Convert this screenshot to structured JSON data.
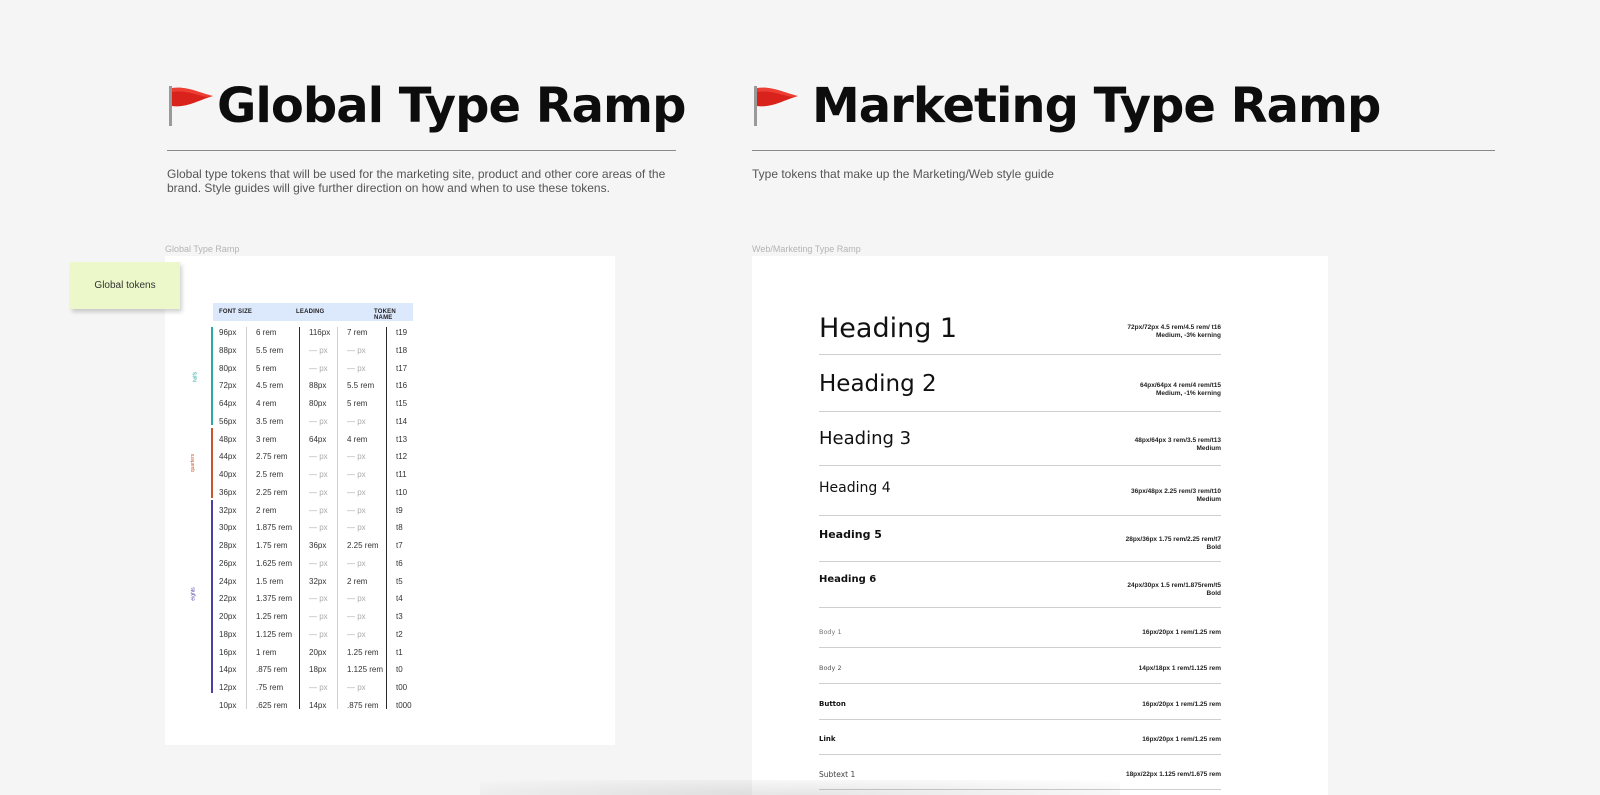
{
  "left": {
    "title": "Global Type Ramp",
    "description": "Global type tokens that will be used for the marketing site, product and other core areas of the brand. Style guides will give further direction on how and when to use these tokens.",
    "frame_label": "Global Type Ramp",
    "sticky_note": "Global tokens",
    "table": {
      "headers": {
        "font_size": "FONT SIZE",
        "leading": "LEADING",
        "token_name": "TOKEN NAME"
      },
      "groups": [
        {
          "label": "halfs",
          "color": "#2aa9a0"
        },
        {
          "label": "quarters",
          "color": "#c8562c"
        },
        {
          "label": "eights",
          "color": "#4a3fa3"
        }
      ],
      "rows": [
        [
          "96px",
          "6 rem",
          "116px",
          "7 rem",
          "t19"
        ],
        [
          "88px",
          "5.5 rem",
          "— px",
          "— px",
          "t18"
        ],
        [
          "80px",
          "5 rem",
          "— px",
          "— px",
          "t17"
        ],
        [
          "72px",
          "4.5 rem",
          "88px",
          "5.5 rem",
          "t16"
        ],
        [
          "64px",
          "4 rem",
          "80px",
          "5 rem",
          "t15"
        ],
        [
          "56px",
          "3.5 rem",
          "— px",
          "— px",
          "t14"
        ],
        [
          "48px",
          "3 rem",
          "64px",
          "4 rem",
          "t13"
        ],
        [
          "44px",
          "2.75 rem",
          "— px",
          "— px",
          "t12"
        ],
        [
          "40px",
          "2.5 rem",
          "— px",
          "— px",
          "t11"
        ],
        [
          "36px",
          "2.25 rem",
          "— px",
          "— px",
          "t10"
        ],
        [
          "32px",
          "2 rem",
          "— px",
          "— px",
          "t9"
        ],
        [
          "30px",
          "1.875 rem",
          "— px",
          "— px",
          "t8"
        ],
        [
          "28px",
          "1.75 rem",
          "36px",
          "2.25 rem",
          "t7"
        ],
        [
          "26px",
          "1.625 rem",
          "— px",
          "— px",
          "t6"
        ],
        [
          "24px",
          "1.5 rem",
          "32px",
          "2 rem",
          "t5"
        ],
        [
          "22px",
          "1.375 rem",
          "— px",
          "— px",
          "t4"
        ],
        [
          "20px",
          "1.25 rem",
          "— px",
          "— px",
          "t3"
        ],
        [
          "18px",
          "1.125 rem",
          "— px",
          "— px",
          "t2"
        ],
        [
          "16px",
          "1 rem",
          "20px",
          "1.25 rem",
          "t1"
        ],
        [
          "14px",
          ".875 rem",
          "18px",
          "1.125 rem",
          "t0"
        ],
        [
          "12px",
          ".75 rem",
          "— px",
          "— px",
          "t00"
        ],
        [
          "10px",
          ".625 rem",
          "14px",
          ".875 rem",
          "t000"
        ]
      ]
    }
  },
  "right": {
    "title": "Marketing Type Ramp",
    "description": "Type tokens that make up the Marketing/Web style guide",
    "frame_label": "Web/Marketing Type Ramp",
    "styles": [
      {
        "name": "Heading 1",
        "spec": "72px/72px 4.5 rem/4.5 rem/ t16",
        "spec2": "Medium, -3% kerning"
      },
      {
        "name": "Heading 2",
        "spec": "64px/64px 4 rem/4 rem/t15",
        "spec2": "Medium, -1% kerning"
      },
      {
        "name": "Heading 3",
        "spec": "48px/64px 3 rem/3.5 rem/t13",
        "spec2": "Medium"
      },
      {
        "name": "Heading 4",
        "spec": "36px/48px 2.25 rem/3 rem/t10",
        "spec2": "Medium"
      },
      {
        "name": "Heading 5",
        "spec": "28px/36px 1.75 rem/2.25 rem/t7",
        "spec2": "Bold"
      },
      {
        "name": "Heading 6",
        "spec": "24px/30px 1.5 rem/1.875rem/t5",
        "spec2": "Bold"
      },
      {
        "name": "Body 1",
        "spec": "16px/20px 1 rem/1.25 rem",
        "spec2": ""
      },
      {
        "name": "Body 2",
        "spec": "14px/18px 1 rem/1.125 rem",
        "spec2": ""
      },
      {
        "name": "Button",
        "spec": "16px/20px 1 rem/1.25 rem",
        "spec2": ""
      },
      {
        "name": "Link",
        "spec": "16px/20px 1 rem/1.25 rem",
        "spec2": ""
      },
      {
        "name": "Subtext 1",
        "spec": "18px/22px 1.125 rem/1.675 rem",
        "spec2": ""
      }
    ]
  },
  "icons": {
    "flag": "red-flag-icon"
  },
  "colors": {
    "flag_red": "#d9221c",
    "header_blue": "#dce8fb",
    "sticky": "#ecf8c9"
  }
}
